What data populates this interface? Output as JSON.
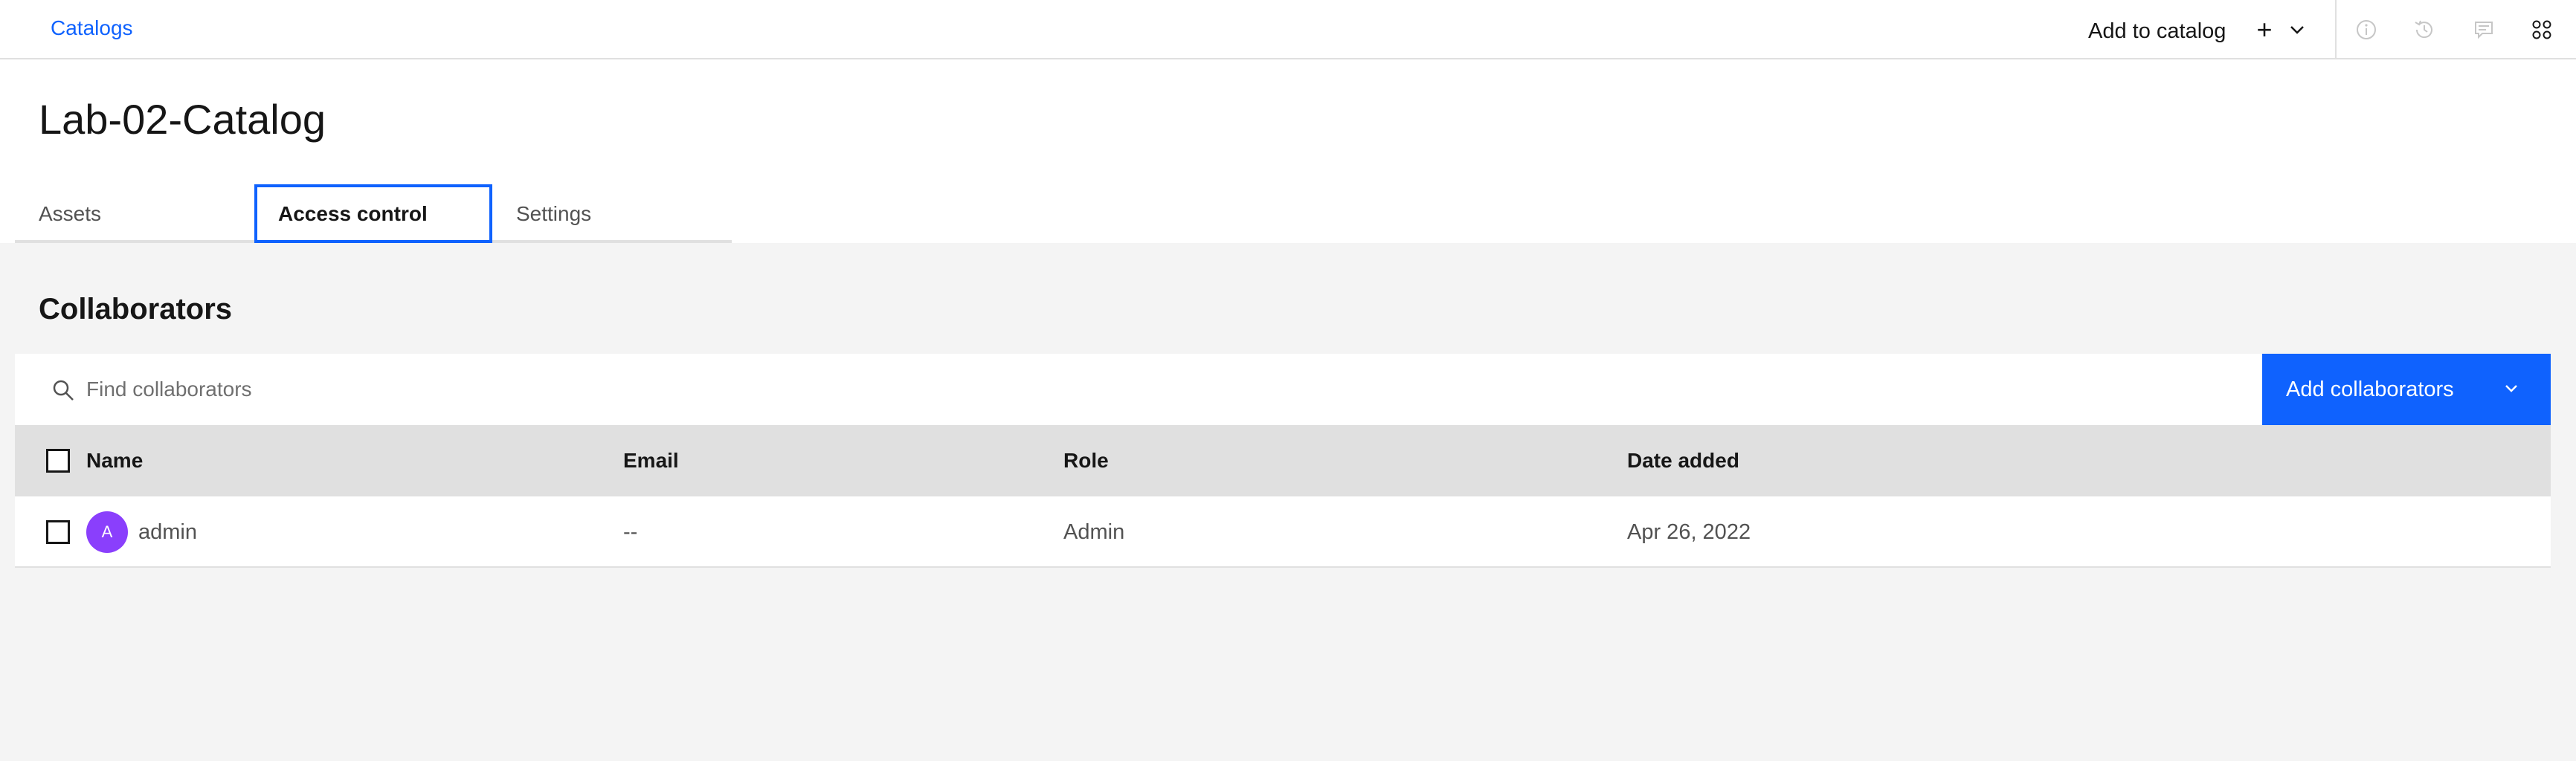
{
  "topbar": {
    "breadcrumb": "Catalogs",
    "add_to_catalog": "Add to catalog",
    "icons": [
      "plus-icon",
      "chevron-down-icon",
      "info-icon",
      "history-icon",
      "chat-icon",
      "apps-icon"
    ]
  },
  "header": {
    "title": "Lab-02-Catalog",
    "tabs": [
      {
        "label": "Assets"
      },
      {
        "label": "Access control"
      },
      {
        "label": "Settings"
      }
    ],
    "active_tab": "Access control"
  },
  "collaborators": {
    "title": "Collaborators",
    "search_placeholder": "Find collaborators",
    "add_button": "Add collaborators",
    "columns": [
      "Name",
      "Email",
      "Role",
      "Date added"
    ],
    "rows": [
      {
        "avatar": "A",
        "name": "admin",
        "email": "--",
        "role": "Admin",
        "date_added": "Apr 26, 2022"
      }
    ]
  },
  "colors": {
    "accent": "#0f62fe",
    "avatar": "#8a3ffc",
    "background": "#f4f4f4",
    "header_row": "#e0e0e0"
  }
}
